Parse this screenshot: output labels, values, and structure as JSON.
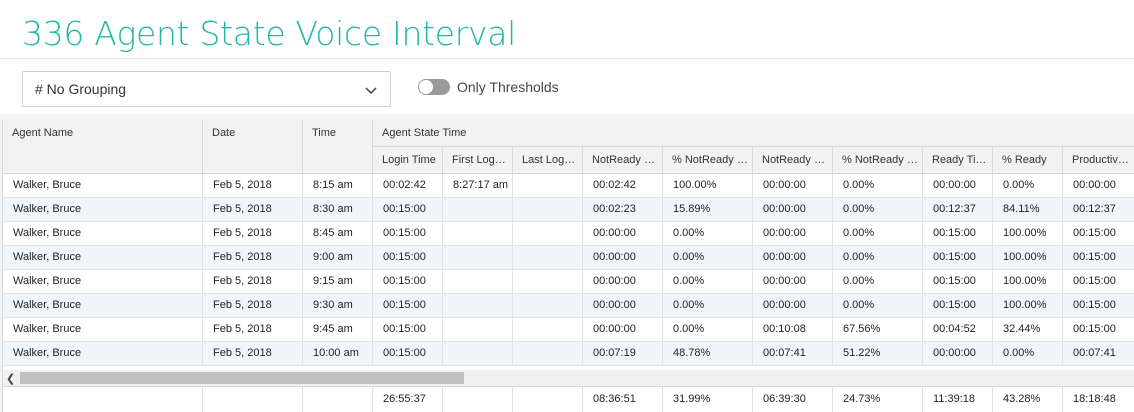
{
  "page": {
    "title": "336 Agent State Voice Interval"
  },
  "controls": {
    "grouping_value": "# No Grouping",
    "toggle_label": "Only Thresholds",
    "toggle_on": false
  },
  "table": {
    "headers": {
      "agent_name": "Agent Name",
      "date": "Date",
      "time": "Time",
      "group": "Agent State Time",
      "sub": [
        "Login Time",
        "First Login...",
        "Last Logo...",
        "NotReady N...",
        "% NotReady N...",
        "NotReady Pr...",
        "% NotReady Pr...",
        "Ready Time",
        "% Ready",
        "Productive..."
      ]
    },
    "rows": [
      [
        "Walker, Bruce",
        "Feb 5, 2018",
        "8:15 am",
        "00:02:42",
        "8:27:17 am",
        "",
        "00:02:42",
        "100.00%",
        "00:00:00",
        "0.00%",
        "00:00:00",
        "0.00%",
        "00:00:00"
      ],
      [
        "Walker, Bruce",
        "Feb 5, 2018",
        "8:30 am",
        "00:15:00",
        "",
        "",
        "00:02:23",
        "15.89%",
        "00:00:00",
        "0.00%",
        "00:12:37",
        "84.11%",
        "00:12:37"
      ],
      [
        "Walker, Bruce",
        "Feb 5, 2018",
        "8:45 am",
        "00:15:00",
        "",
        "",
        "00:00:00",
        "0.00%",
        "00:00:00",
        "0.00%",
        "00:15:00",
        "100.00%",
        "00:15:00"
      ],
      [
        "Walker, Bruce",
        "Feb 5, 2018",
        "9:00 am",
        "00:15:00",
        "",
        "",
        "00:00:00",
        "0.00%",
        "00:00:00",
        "0.00%",
        "00:15:00",
        "100.00%",
        "00:15:00"
      ],
      [
        "Walker, Bruce",
        "Feb 5, 2018",
        "9:15 am",
        "00:15:00",
        "",
        "",
        "00:00:00",
        "0.00%",
        "00:00:00",
        "0.00%",
        "00:15:00",
        "100.00%",
        "00:15:00"
      ],
      [
        "Walker, Bruce",
        "Feb 5, 2018",
        "9:30 am",
        "00:15:00",
        "",
        "",
        "00:00:00",
        "0.00%",
        "00:00:00",
        "0.00%",
        "00:15:00",
        "100.00%",
        "00:15:00"
      ],
      [
        "Walker, Bruce",
        "Feb 5, 2018",
        "9:45 am",
        "00:15:00",
        "",
        "",
        "00:00:00",
        "0.00%",
        "00:10:08",
        "67.56%",
        "00:04:52",
        "32.44%",
        "00:15:00"
      ],
      [
        "Walker, Bruce",
        "Feb 5, 2018",
        "10:00 am",
        "00:15:00",
        "",
        "",
        "00:07:19",
        "48.78%",
        "00:07:41",
        "51.22%",
        "00:00:00",
        "0.00%",
        "00:07:41"
      ]
    ],
    "totals": [
      "",
      "",
      "",
      "26:55:37",
      "",
      "",
      "08:36:51",
      "31.99%",
      "06:39:30",
      "24.73%",
      "11:39:18",
      "43.28%",
      "18:18:48"
    ]
  },
  "icons": {
    "grouping_chevron": "chevron-down-icon",
    "scroll_left": "chevron-left-icon"
  }
}
